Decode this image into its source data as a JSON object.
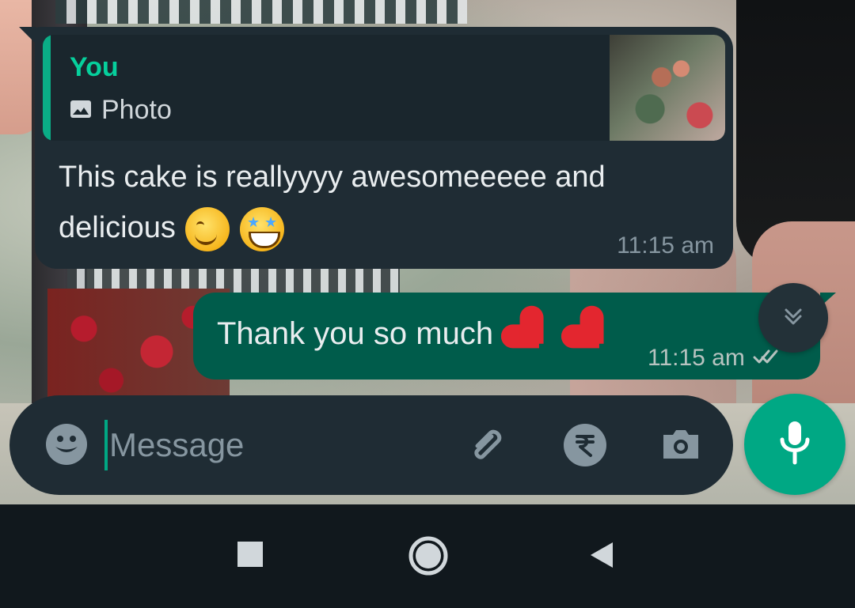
{
  "chat": {
    "quoted": {
      "author": "You",
      "type_label": "Photo"
    },
    "incoming_message": {
      "text_line_1": "This cake is reallyyyy awesomeeeee and",
      "text_line_2": "delicious",
      "timestamp": "11:15 am"
    },
    "outgoing_message": {
      "text": "Thank you so much",
      "timestamp": "11:15 am",
      "status": "read"
    }
  },
  "composer": {
    "placeholder": "Message"
  },
  "colors": {
    "incoming_bubble": "#1f2c34",
    "outgoing_bubble": "#005c4b",
    "accent": "#00a884",
    "quote_accent": "#06cf9c",
    "muted_text": "#8696a0",
    "primary_text": "#e9edef",
    "read_receipt": "#b7c3c0"
  },
  "icons": {
    "photo": "image-icon",
    "emoji": "emoji-icon",
    "attach": "paperclip-icon",
    "payment": "rupee-icon",
    "camera": "camera-icon",
    "mic": "mic-icon",
    "scroll_down": "double-chevron-down-icon",
    "read": "double-check-icon",
    "recents": "square-icon",
    "home": "circle-icon",
    "back": "triangle-back-icon"
  }
}
